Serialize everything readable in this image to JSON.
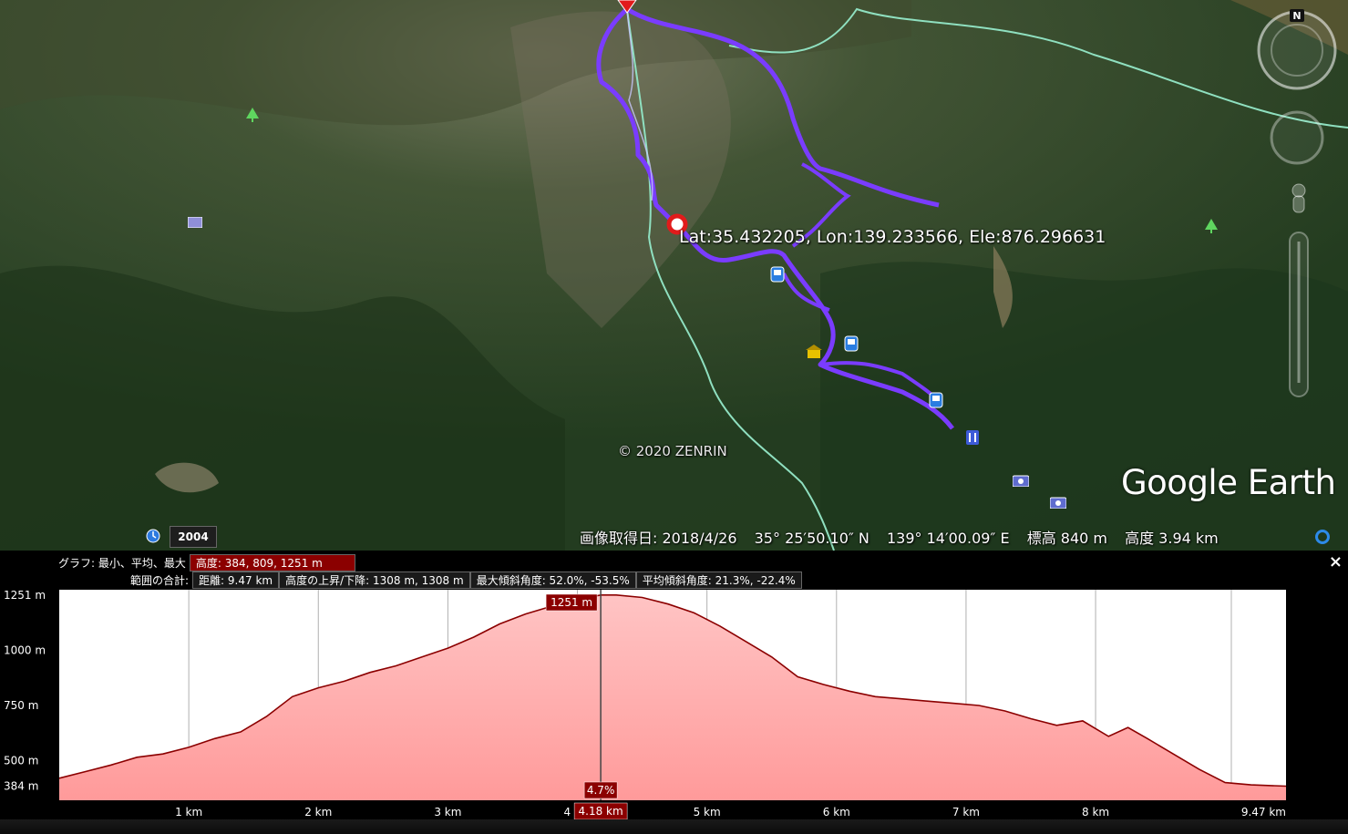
{
  "map": {
    "coordinate_label": "Lat:35.432205, Lon:139.233566, Ele:876.296631",
    "copyright": "© 2020 ZENRIN",
    "brand": "Google Earth",
    "compass_letter": "N",
    "timeline_year": "2004",
    "status": {
      "imagery_date": "画像取得日: 2018/4/26",
      "latitude": "35° 25′50.10″ N",
      "longitude": "139° 14′00.09″ E",
      "elevation": "標高   840 m",
      "altitude": "高度   3.94 km"
    },
    "icons": [
      "clock-icon",
      "compass-icon",
      "zoom-slider",
      "pegman-icon",
      "refresh-icon",
      "start-pin-icon",
      "placemark-icon",
      "train-icon",
      "shrine-icon",
      "restaurant-icon",
      "camera-icon",
      "tree-icon",
      "hotel-icon"
    ]
  },
  "elevation_panel": {
    "graph_label": "グラフ: 最小、平均、最大",
    "elevation_stats": "高度: 384, 809, 1251 m",
    "range_label": "範囲の合計:",
    "distance": "距離: 9.47 km",
    "gain_loss": "高度の上昇/下降: 1308 m, 1308 m",
    "max_slope": "最大傾斜角度: 52.0%, -53.5%",
    "avg_slope": "平均傾斜角度: 21.3%, -22.4%",
    "cursor_elevation": "1251 m",
    "cursor_slope": "4.7%",
    "cursor_distance": "4.18 km",
    "close_symbol": "×",
    "colors": {
      "fill_top": "#ffd0d0",
      "line": "#8b0000",
      "highlight": "#8b0000"
    }
  },
  "chart_data": {
    "type": "area",
    "xlabel": "",
    "ylabel": "",
    "xlim": [
      0,
      9.47
    ],
    "ylim": [
      384,
      1251
    ],
    "y_ticks": [
      "1251 m",
      "1000 m",
      "750 m",
      "500 m",
      "384 m"
    ],
    "y_tick_values": [
      1251,
      1000,
      750,
      500,
      384
    ],
    "x_ticks": [
      "1 km",
      "2 km",
      "3 km",
      "4 km",
      "5 km",
      "6 km",
      "7 km",
      "8 km",
      "9.47 km"
    ],
    "x_tick_values": [
      1,
      2,
      3,
      4,
      5,
      6,
      7,
      8,
      9.47
    ],
    "grid": true,
    "x": [
      0,
      0.2,
      0.4,
      0.6,
      0.8,
      1.0,
      1.2,
      1.4,
      1.6,
      1.8,
      2.0,
      2.2,
      2.4,
      2.6,
      2.8,
      3.0,
      3.2,
      3.4,
      3.6,
      3.8,
      4.0,
      4.18,
      4.3,
      4.5,
      4.7,
      4.9,
      5.1,
      5.3,
      5.5,
      5.7,
      5.9,
      6.1,
      6.3,
      6.5,
      6.7,
      6.9,
      7.1,
      7.3,
      7.5,
      7.7,
      7.9,
      8.0,
      8.1,
      8.25,
      8.4,
      8.6,
      8.8,
      9.0,
      9.2,
      9.47
    ],
    "y": [
      420,
      450,
      480,
      515,
      530,
      560,
      600,
      630,
      700,
      790,
      830,
      860,
      900,
      930,
      970,
      1010,
      1060,
      1120,
      1165,
      1200,
      1230,
      1251,
      1251,
      1240,
      1210,
      1170,
      1110,
      1040,
      970,
      880,
      845,
      815,
      790,
      780,
      770,
      760,
      750,
      725,
      690,
      660,
      680,
      645,
      610,
      650,
      600,
      530,
      460,
      400,
      390,
      384
    ],
    "cursor_x": 4.18
  }
}
